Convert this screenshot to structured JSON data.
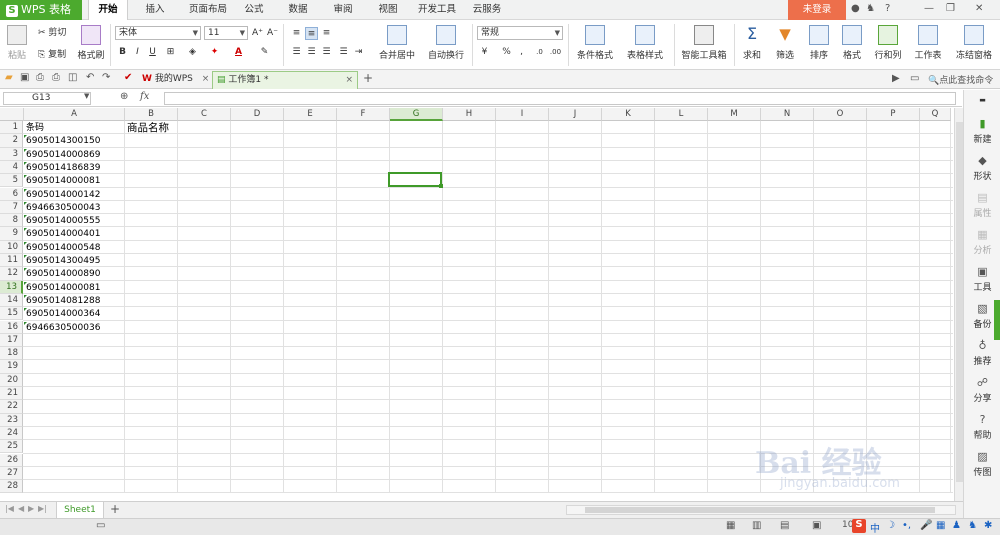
{
  "app": {
    "title": "WPS 表格",
    "login": "未登录"
  },
  "menu": [
    "开始",
    "插入",
    "页面布局",
    "公式",
    "数据",
    "审阅",
    "视图",
    "开发工具",
    "云服务"
  ],
  "ribbon": {
    "paste": "粘贴",
    "cut": "剪切",
    "copy": "复制",
    "format_painter": "格式刷",
    "font_name": "宋体",
    "font_size": "11",
    "bold": "B",
    "italic": "I",
    "underline": "U",
    "merge": "合并居中",
    "wrap": "自动换行",
    "number_format": "常规",
    "percent": "%",
    "conditional": "条件格式",
    "table_style": "表格样式",
    "smart_toolbox": "智能工具箱",
    "sum": "求和",
    "filter": "筛选",
    "sort": "排序",
    "format": "格式",
    "row_col": "行和列",
    "worksheet": "工作表",
    "freeze": "冻结窗格"
  },
  "doc_tabs": {
    "my_wps": "我的WPS",
    "workbook": "工作簿1 *",
    "find_cmd": "点此查找命令"
  },
  "formula_bar": {
    "cell_ref": "G13",
    "fx": "fx"
  },
  "columns": [
    "A",
    "B",
    "C",
    "D",
    "E",
    "F",
    "G",
    "H",
    "I",
    "J",
    "K",
    "L",
    "M",
    "N",
    "O",
    "P",
    "Q"
  ],
  "selected_column": "G",
  "selected_row": 13,
  "rows": [
    "1",
    "2",
    "3",
    "4",
    "5",
    "6",
    "7",
    "8",
    "9",
    "10",
    "11",
    "12",
    "13",
    "14",
    "15",
    "16",
    "17",
    "18",
    "19",
    "20",
    "21",
    "22",
    "23",
    "24",
    "25",
    "26",
    "27",
    "28"
  ],
  "headers": {
    "A": "条码",
    "B": "商品名称"
  },
  "barcodes": [
    "6905014300150",
    "6905014000869",
    "6905014186839",
    "6905014000081",
    "6905014000142",
    "6946630500043",
    "6905014000555",
    "6905014000401",
    "6905014000548",
    "6905014300495",
    "6905014000890",
    "6905014000081",
    "6905014081288",
    "6905014000364",
    "6946630500036"
  ],
  "sheet": {
    "name": "Sheet1",
    "add": "+"
  },
  "status": {
    "zoom": "10"
  },
  "taskpane": [
    "新建",
    "形状",
    "属性",
    "分析",
    "工具",
    "备份",
    "推荐",
    "分享",
    "帮助",
    "传图"
  ],
  "watermark": {
    "main": "Bai 经验",
    "sub": "jingyan.baidu.com"
  }
}
